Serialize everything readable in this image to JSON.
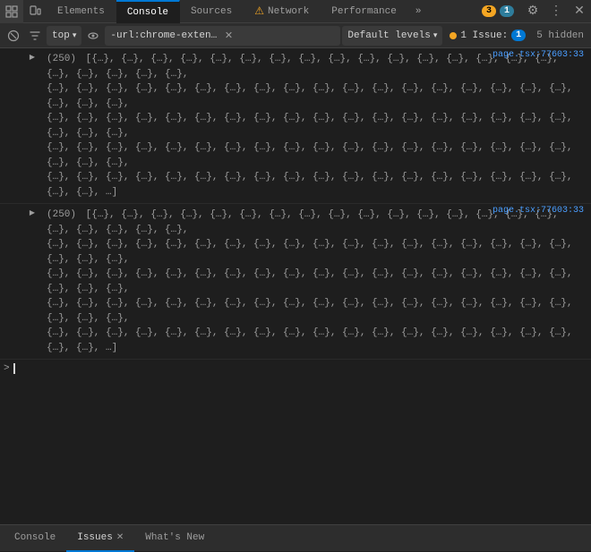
{
  "tabs": {
    "items": [
      {
        "label": "Elements",
        "active": false,
        "icon": ""
      },
      {
        "label": "Console",
        "active": true,
        "icon": ""
      },
      {
        "label": "Sources",
        "active": false,
        "icon": ""
      },
      {
        "label": "Network",
        "active": false,
        "icon": "",
        "warning": true
      },
      {
        "label": "Performance",
        "active": false,
        "icon": ""
      },
      {
        "label": "More",
        "active": false,
        "icon": ""
      }
    ],
    "badges": {
      "orange": "3",
      "blue": "1"
    },
    "icons": {
      "settings": "⚙",
      "more": "⋮"
    }
  },
  "toolbar": {
    "top_label": "top",
    "url": "-url:chrome-extension://fmkadmapg",
    "url_full": "-url:chrome-extension://fmkadmapgofadopljbjfkapdkoienihi",
    "default_levels": "Default levels",
    "issue_label": "1 Issue:",
    "issue_count": "1",
    "hidden_count": "5 hidden"
  },
  "console": {
    "entries": [
      {
        "id": 1,
        "source_file": "page.tsx",
        "source_line": "77603:33",
        "count": "(250)",
        "content": "[{…}, {…}, {…}, {…}, {…}, {…}, {…}, {…}, {…}, {…}, {…}, {…}, {…}, {…}, {…}, {…}, {…}, {…}, {…}, {…}, {…}, {…}, {…}, {…}, {…}, {…}, {…}, {…}, {…}, {…}, {…}, {…}, {…}, {…}, {…}, {…}, {…}, {…}, {…}, {…}, {…}, {…}, {…}, {…}, {…}, {…}, {…}, {…}, {…}, {…}, {…}, {…}, {…}, {…}, {…}, {…}, {…}, {…}, {…}, {…}, {…}, {…}, {…}, {…}, {…}, {…}, {…}, {…}, {…}, {…}, {…}, {…}, {…}, {…}, {…}, {…}, {…}, {…}, {…}, {…}, {…}, {…}, {…}, {…}, {…}, {…}, {…}, {…}, {…}, {…}, {…}, {…}, {…}, {…}, {…}, {…}, {…}, {…}, {…}, {…}, {…}, {…}, {…}, {…}, {…}, {…}, {…}, {…}, {…}, {…}, {…}, {…}, {…}, {…}, {…}, {…}, {…}, {…}, {…}, {…}, {…}, {…}, {…}, {…}, {…}, {…}, {…}, {…}, {…}, {…}, {…}, {…}, {…}, {…}, {…}, {…}, {…}, {…}, {…}, {…}, {…}, {…}, {…}, {…}, {…}, {…}, {…}, {…}, {…}, {…}, {…}, {…}, {…}, {…}, {…}, {…}, {…}, {…}, {…}, {…}, {…}, {…}, {…}, {…}, {…}, {…}, {…}, {…}, {…}, {…}, {…}, {…}, {…}, {…}, {…}, {…}, {…}, {…}, {…}, {…}, {…}, {…}, {…}, {…}, {…}, {…}, {…}, {…}, {…}, {…}, {…}, {…}, {…}, {…}, {…}, {…}, {…}, {…}, {…}, {…}, {…}, {…}, {…}, {…}, {…}, {…}, {…}, {…}, {…}, {…}, {…}, {…}, {…}, {…}, {…}, {…}, {…}, {…}, {…}, {…}, {…}, {…}, {…}, {…}, {…}, {…}, {…}, {…}, {…}, {…}, {…}, {…}, {…}, {…}, {…}, {…}, {…}, {…}, {…}, {…}, {…}, {…}, {…}, {…}, {…}, {…}, {…}, {…}, {…}, {…}, …]"
      },
      {
        "id": 2,
        "source_file": "page.tsx",
        "source_line": "77603:33",
        "count": "(250)",
        "content": "[{…}, {…}, {…}, {…}, {…}, {…}, {…}, {…}, {…}, {…}, {…}, {…}, {…}, {…}, {…}, {…}, {…}, {…}, {…}, {…}, {…}, {…}, {…}, {…}, {…}, {…}, {…}, {…}, {…}, {…}, {…}, {…}, {…}, {…}, {…}, {…}, {…}, {…}, {…}, {…}, {…}, {…}, {…}, {…}, {…}, {…}, {…}, {…}, {…}, {…}, {…}, {…}, {…}, {…}, {…}, {…}, {…}, {…}, {…}, {…}, {…}, {…}, {…}, {…}, {…}, {…}, {…}, {…}, {…}, {…}, {…}, {…}, {…}, {…}, {…}, {…}, {…}, {…}, {…}, {…}, {…}, {…}, {…}, {…}, {…}, {…}, {…}, {…}, {…}, {…}, {…}, {…}, {…}, {…}, {…}, {…}, {…}, {…}, {…}, {…}, {…}, {…}, {…}, {…}, {…}, {…}, {…}, {…}, {…}, {…}, {…}, {…}, {…}, {…}, {…}, {…}, {…}, {…}, {…}, {…}, {…}, {…}, {…}, {…}, {…}, {…}, {…}, {…}, {…}, {…}, {…}, {…}, {…}, {…}, {…}, {…}, {…}, {…}, {…}, {…}, {…}, {…}, {…}, {…}, {…}, {…}, {…}, {…}, {…}, {…}, {…}, {…}, {…}, {…}, {…}, {…}, {…}, {…}, {…}, {…}, {…}, {…}, {…}, {…}, {…}, {…}, {…}, {…}, {…}, {…}, {…}, {…}, {…}, {…}, {…}, {…}, {…}, {…}, {…}, {…}, {…}, {…}, {…}, {…}, {…}, {…}, {…}, {…}, {…}, {…}, {…}, {…}, {…}, {…}, {…}, {…}, {…}, {…}, {…}, {…}, {…}, {…}, {…}, {…}, {…}, {…}, {…}, {…}, {…}, {…}, {…}, {…}, {…}, {…}, {…}, {…}, {…}, {…}, {…}, {…}, {…}, {…}, {…}, {…}, {…}, {…}, {…}, {…}, {…}, {…}, {…}, {…}, {…}, {…}, {…}, {…}, {…}, {…}, {…}, {…}, {…}, {…}, {…}, {…}, {…}, {…}, {…}, {…}, {…}, {…}, …]"
      }
    ],
    "cursor_prompt": ">"
  },
  "bottom_tabs": [
    {
      "label": "Console",
      "active": false,
      "closeable": false
    },
    {
      "label": "Issues",
      "active": true,
      "closeable": true
    },
    {
      "label": "What's New",
      "active": false,
      "closeable": false
    }
  ],
  "icons": {
    "inspect": "⬚",
    "prohibit": "⊘",
    "chevron_down": "▾",
    "eye": "👁",
    "clear": "🚫",
    "settings": "⚙",
    "more_tabs": "»",
    "close": "×",
    "arrow_right": "▶",
    "warning": "⚠"
  }
}
